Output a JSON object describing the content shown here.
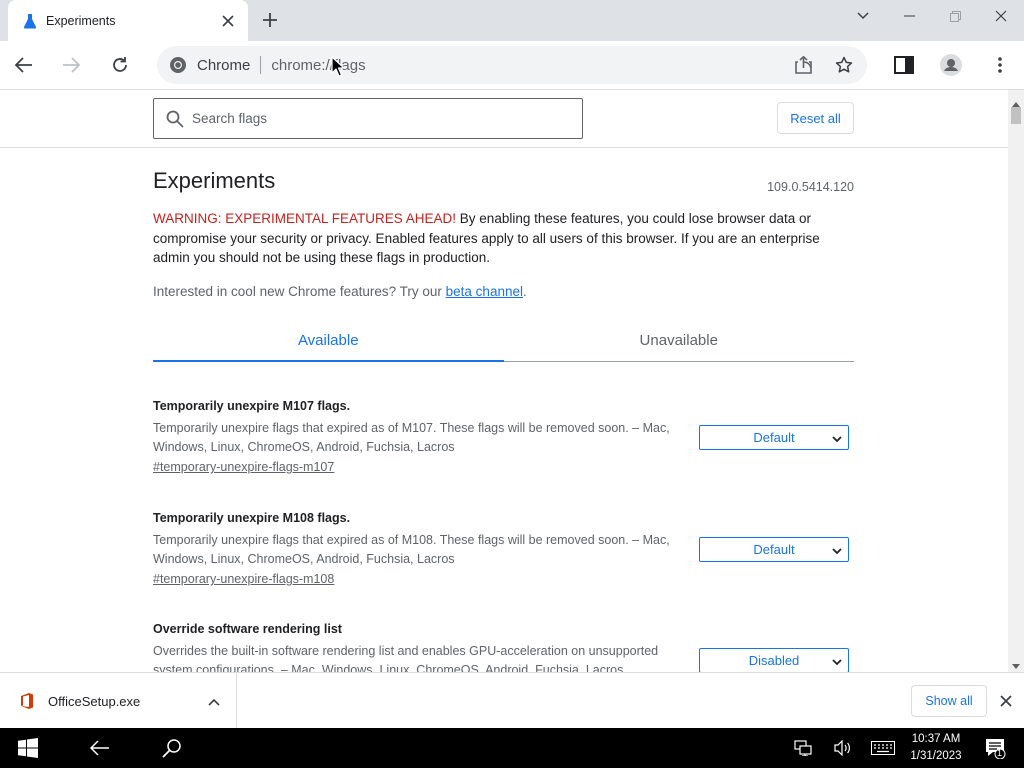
{
  "browser": {
    "tab_title": "Experiments",
    "omnibox_site": "Chrome",
    "omnibox_url": "chrome://flags"
  },
  "flags_page": {
    "search_placeholder": "Search flags",
    "reset_label": "Reset all",
    "title": "Experiments",
    "version": "109.0.5414.120",
    "warning_prefix": "WARNING: EXPERIMENTAL FEATURES AHEAD!",
    "warning_body": " By enabling these features, you could lose browser data or compromise your security or privacy. Enabled features apply to all users of this browser. If you are an enterprise admin you should not be using these flags in production.",
    "interest_text": "Interested in cool new Chrome features? Try our ",
    "interest_link": "beta channel",
    "interest_end": ".",
    "tabs": [
      {
        "label": "Available",
        "active": true
      },
      {
        "label": "Unavailable",
        "active": false
      }
    ],
    "flags": [
      {
        "name": "Temporarily unexpire M107 flags.",
        "desc": "Temporarily unexpire flags that expired as of M107. These flags will be removed soon. – Mac, Windows, Linux, ChromeOS, Android, Fuchsia, Lacros",
        "link": "#temporary-unexpire-flags-m107",
        "value": "Default"
      },
      {
        "name": "Temporarily unexpire M108 flags.",
        "desc": "Temporarily unexpire flags that expired as of M108. These flags will be removed soon. – Mac, Windows, Linux, ChromeOS, Android, Fuchsia, Lacros",
        "link": "#temporary-unexpire-flags-m108",
        "value": "Default"
      },
      {
        "name": "Override software rendering list",
        "desc": "Overrides the built-in software rendering list and enables GPU-acceleration on unsupported system configurations. – Mac, Windows, Linux, ChromeOS, Android, Fuchsia, Lacros",
        "link": "",
        "value": "Disabled"
      }
    ]
  },
  "download_bar": {
    "filename": "OfficeSetup.exe",
    "show_all": "Show all"
  },
  "taskbar": {
    "time": "10:37 AM",
    "date": "1/31/2023",
    "notification_count": "1"
  },
  "colors": {
    "accent": "#1a73e8",
    "warning": "#c5221f",
    "office": "#d83b01"
  }
}
